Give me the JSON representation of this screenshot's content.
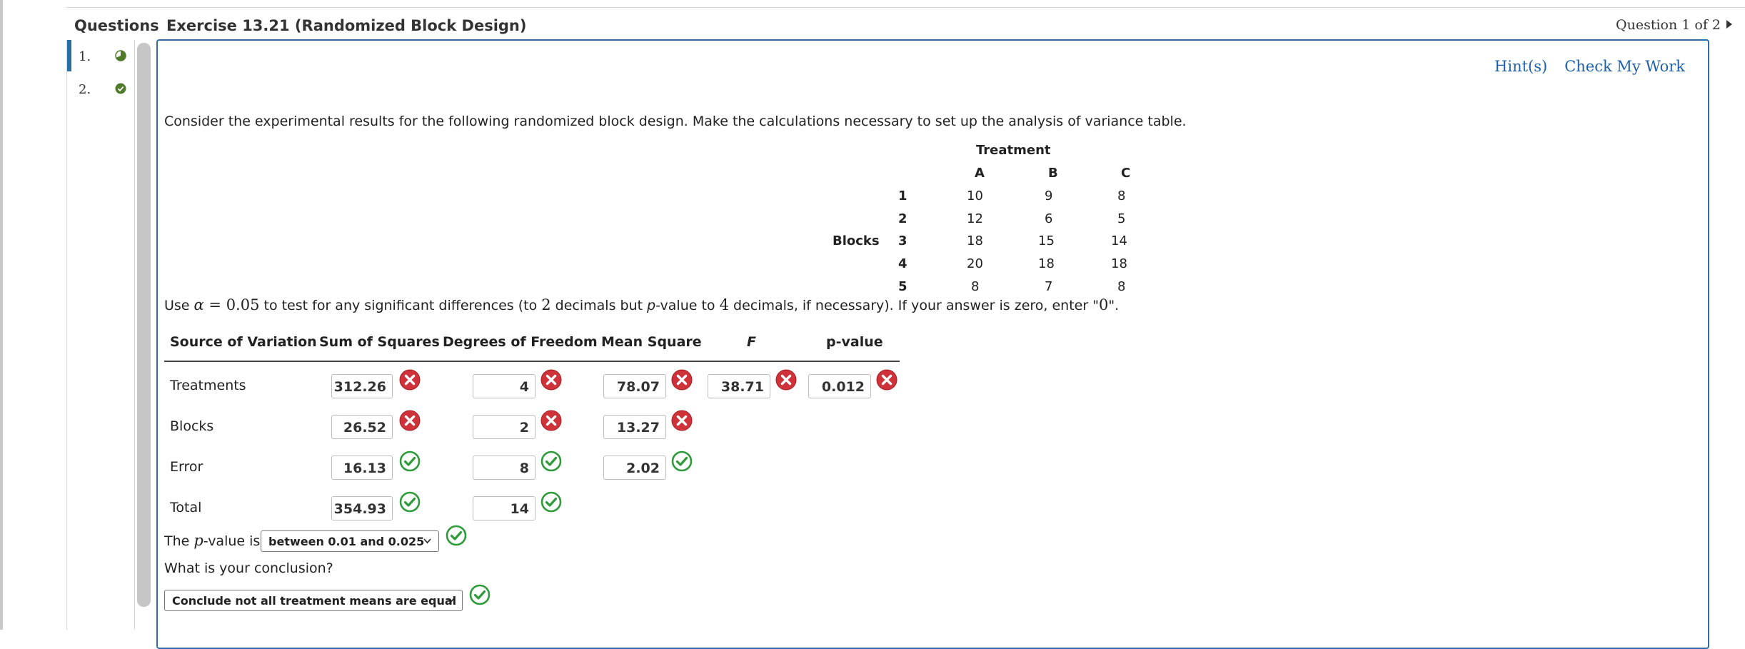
{
  "header": {
    "questions_label": "Questions",
    "exercise_title": "Exercise 13.21 (Randomized Block Design)",
    "question_counter": "Question 1 of 2"
  },
  "sidebar": {
    "items": [
      {
        "label": "1.",
        "status": "partial"
      },
      {
        "label": "2.",
        "status": "complete"
      }
    ]
  },
  "links": {
    "hints": "Hint(s)",
    "check": "Check My Work"
  },
  "prompt": "Consider the experimental results for the following randomized block design. Make the calculations necessary to set up the analysis of variance table.",
  "data_table": {
    "treatment_header": "Treatment",
    "blocks_label": "Blocks",
    "columns": [
      "A",
      "B",
      "C"
    ],
    "rows": [
      {
        "block": "1",
        "values": [
          "10",
          "9",
          "8"
        ]
      },
      {
        "block": "2",
        "values": [
          "12",
          "6",
          "5"
        ]
      },
      {
        "block": "3",
        "values": [
          "18",
          "15",
          "14"
        ]
      },
      {
        "block": "4",
        "values": [
          "20",
          "18",
          "18"
        ]
      },
      {
        "block": "5",
        "values": [
          "8",
          "7",
          "8"
        ]
      }
    ]
  },
  "instruction": {
    "use": "Use ",
    "alpha": "α",
    "eq": " = ",
    "alpha_val": "0.05",
    "mid1": " to test for any significant differences (to ",
    "two": "2",
    "mid2": " decimals but ",
    "p": "p",
    "mid3": "-value to ",
    "four": "4",
    "mid4": " decimals, if necessary). If your answer is zero, enter \"",
    "zero": "0",
    "end": "\"."
  },
  "anova": {
    "headers": [
      "Source of Variation",
      "Sum of Squares",
      "Degrees of Freedom",
      "Mean Square",
      "F",
      "p-value"
    ],
    "rows": [
      {
        "source": "Treatments",
        "ss": "312.26",
        "ss_ok": false,
        "df": "4",
        "df_ok": false,
        "ms": "78.07",
        "ms_ok": false,
        "f": "38.71",
        "f_ok": false,
        "p": "0.012",
        "p_ok": false
      },
      {
        "source": "Blocks",
        "ss": "26.52",
        "ss_ok": false,
        "df": "2",
        "df_ok": false,
        "ms": "13.27",
        "ms_ok": false
      },
      {
        "source": "Error",
        "ss": "16.13",
        "ss_ok": true,
        "df": "8",
        "df_ok": true,
        "ms": "2.02",
        "ms_ok": true
      },
      {
        "source": "Total",
        "ss": "354.93",
        "ss_ok": true,
        "df": "14",
        "df_ok": true
      }
    ]
  },
  "pvalue_question": {
    "prefix": "The ",
    "p": "p",
    "suffix": "-value is",
    "selected": "between 0.01 and 0.025",
    "correct": true
  },
  "conclusion": {
    "question": "What is your conclusion?",
    "selected": "Conclude not all treatment means are equal",
    "correct": true
  },
  "colors": {
    "accent": "#2f6ca8",
    "link": "#2060a8",
    "correct": "#2e9b3a",
    "incorrect": "#d0323a"
  }
}
